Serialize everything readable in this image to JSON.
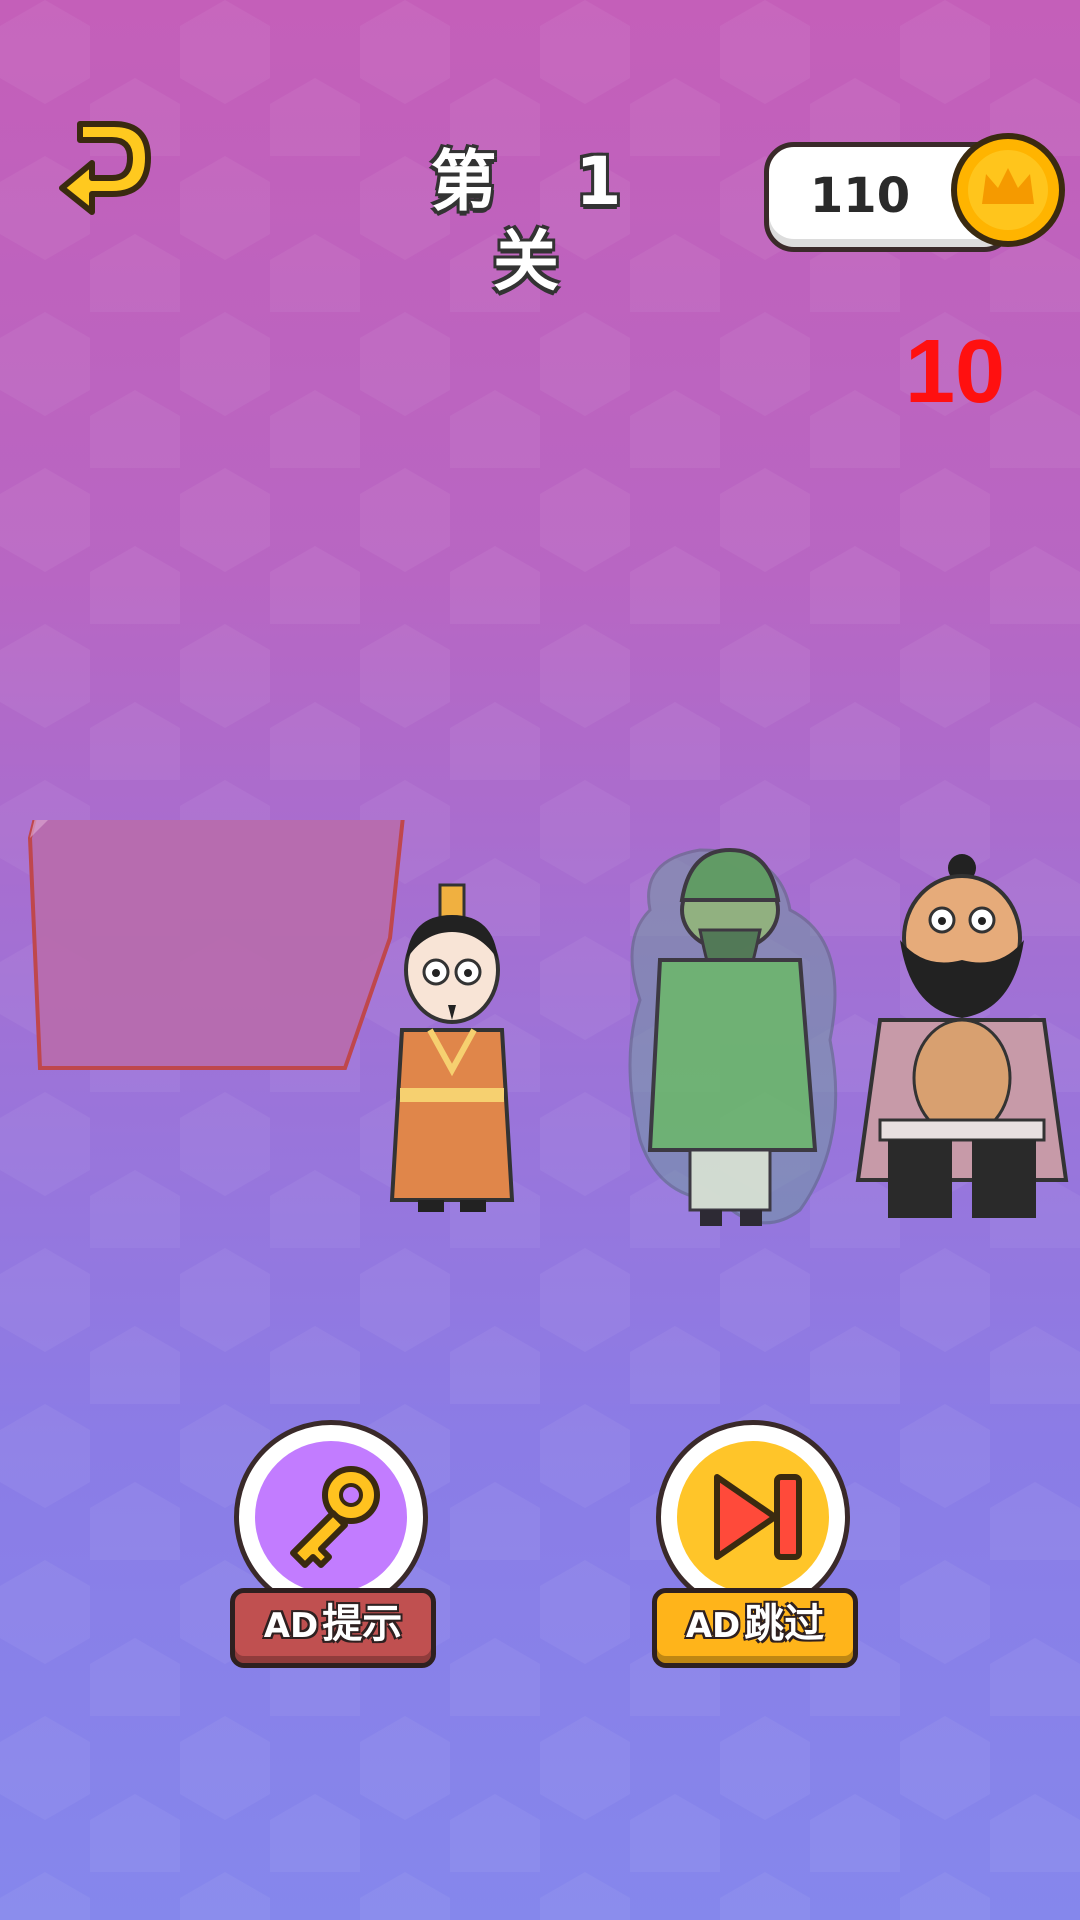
{
  "header": {
    "back_icon": "back-arrow-icon",
    "level_title": "第 1 关",
    "coins": "110",
    "coin_icon": "crown-coin-icon"
  },
  "timer": "10",
  "scene": {
    "items": [
      "rock",
      "official-character",
      "green-general-ghost",
      "bearded-warrior"
    ]
  },
  "actions": {
    "hint": {
      "ad_tag": "AD",
      "label": "提示",
      "icon": "key-icon",
      "color": "#c27cff"
    },
    "skip": {
      "ad_tag": "AD",
      "label": "跳过",
      "icon": "skip-icon",
      "color": "#ffc529"
    }
  },
  "colors": {
    "accent_yellow": "#ffc529",
    "timer_red": "#ff1010",
    "hint_red": "#c05050"
  }
}
